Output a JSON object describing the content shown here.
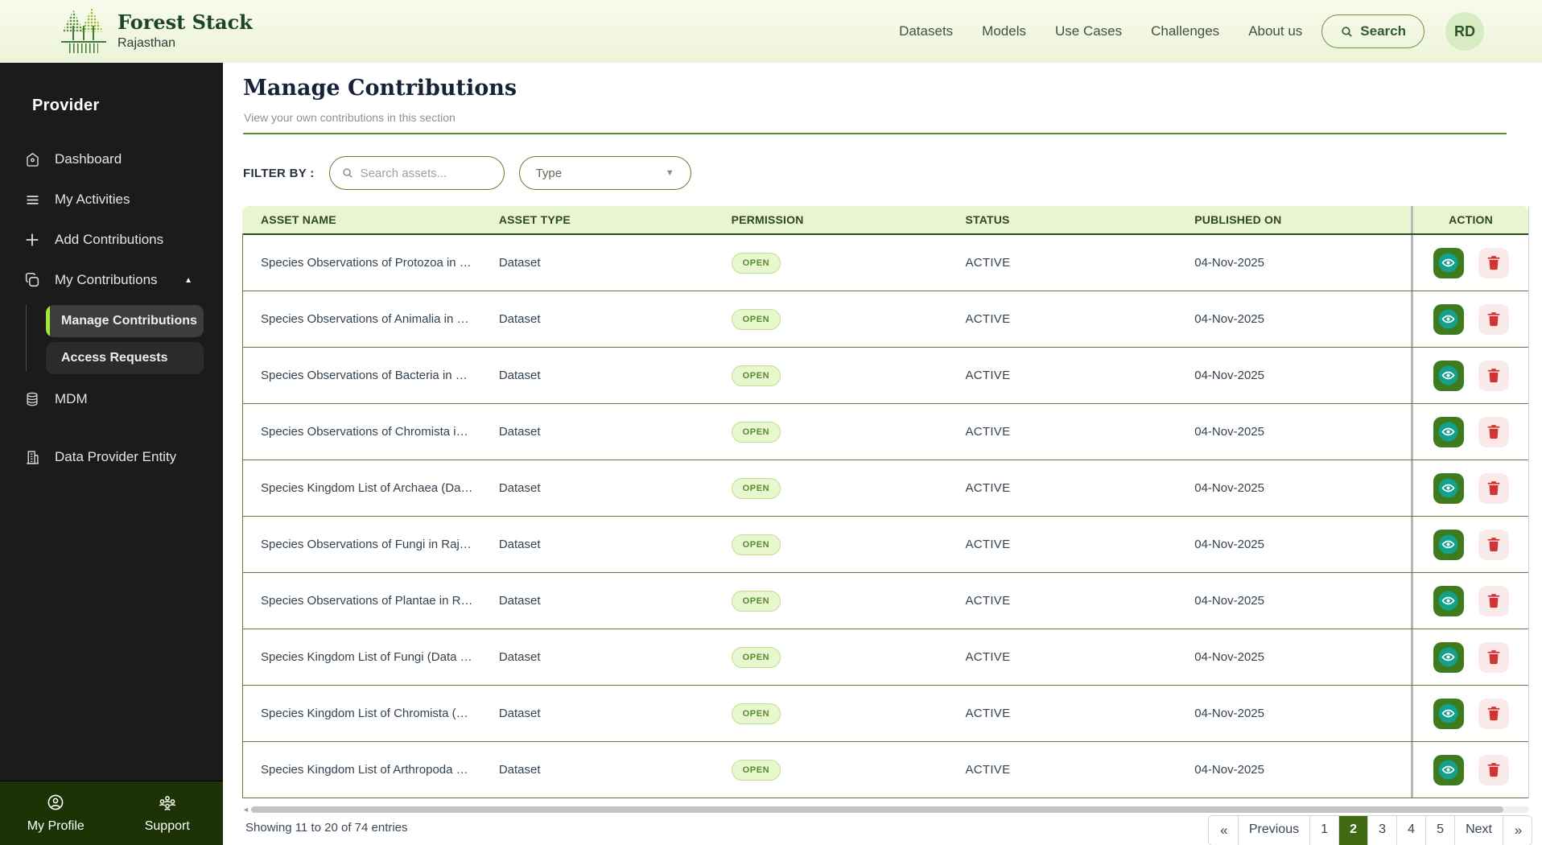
{
  "header": {
    "logo": {
      "title": "Forest Stack",
      "subtitle": "Rajasthan"
    },
    "nav": [
      "Datasets",
      "Models",
      "Use Cases",
      "Challenges",
      "About us"
    ],
    "search_label": "Search",
    "avatar_initials": "RD"
  },
  "sidebar": {
    "section_title": "Provider",
    "items": [
      {
        "label": "Dashboard"
      },
      {
        "label": "My Activities"
      },
      {
        "label": "Add Contributions"
      },
      {
        "label": "My Contributions",
        "expanded": true,
        "children": [
          {
            "label": "Manage Contributions",
            "active": true
          },
          {
            "label": "Access Requests",
            "active": false
          }
        ]
      },
      {
        "label": "MDM"
      },
      {
        "label": "Data Provider Entity"
      }
    ],
    "footer_items": [
      {
        "label": "My Profile"
      },
      {
        "label": "Support"
      }
    ]
  },
  "main": {
    "title": "Manage Contributions",
    "subtitle": "View your own contributions in this section",
    "filter": {
      "label": "FILTER BY :",
      "search_placeholder": "Search assets...",
      "type_label": "Type"
    },
    "table": {
      "columns": [
        "ASSET NAME",
        "ASSET TYPE",
        "PERMISSION",
        "STATUS",
        "PUBLISHED ON",
        "ACTION"
      ],
      "rows": [
        {
          "name": "Species Observations of Protozoa in …",
          "type": "Dataset",
          "permission": "OPEN",
          "status": "ACTIVE",
          "published": "04-Nov-2025"
        },
        {
          "name": "Species Observations of Animalia in …",
          "type": "Dataset",
          "permission": "OPEN",
          "status": "ACTIVE",
          "published": "04-Nov-2025"
        },
        {
          "name": "Species Observations of Bacteria in …",
          "type": "Dataset",
          "permission": "OPEN",
          "status": "ACTIVE",
          "published": "04-Nov-2025"
        },
        {
          "name": "Species Observations of Chromista i…",
          "type": "Dataset",
          "permission": "OPEN",
          "status": "ACTIVE",
          "published": "04-Nov-2025"
        },
        {
          "name": "Species Kingdom List of Archaea (Da…",
          "type": "Dataset",
          "permission": "OPEN",
          "status": "ACTIVE",
          "published": "04-Nov-2025"
        },
        {
          "name": "Species Observations of Fungi in Raj…",
          "type": "Dataset",
          "permission": "OPEN",
          "status": "ACTIVE",
          "published": "04-Nov-2025"
        },
        {
          "name": "Species Observations of Plantae in R…",
          "type": "Dataset",
          "permission": "OPEN",
          "status": "ACTIVE",
          "published": "04-Nov-2025"
        },
        {
          "name": "Species Kingdom List of Fungi (Data …",
          "type": "Dataset",
          "permission": "OPEN",
          "status": "ACTIVE",
          "published": "04-Nov-2025"
        },
        {
          "name": "Species Kingdom List of Chromista (…",
          "type": "Dataset",
          "permission": "OPEN",
          "status": "ACTIVE",
          "published": "04-Nov-2025"
        },
        {
          "name": "Species Kingdom List of Arthropoda …",
          "type": "Dataset",
          "permission": "OPEN",
          "status": "ACTIVE",
          "published": "04-Nov-2025"
        }
      ]
    },
    "footer": {
      "showing_text": "Showing 11 to 20 of 74 entries",
      "pagination": {
        "first": "«",
        "previous": "Previous",
        "pages": [
          "1",
          "2",
          "3",
          "4",
          "5"
        ],
        "active_page": "2",
        "next": "Next",
        "last": "»"
      }
    }
  },
  "colors": {
    "accent_green_dark": "#3f6a12",
    "accent_lime": "#a5e635",
    "header_bg": "#f4f8e4",
    "table_header_bg": "#e9f4d2",
    "badge_green_text": "#568a2e",
    "delete_red": "#d13434",
    "view_teal": "#14a18b"
  }
}
